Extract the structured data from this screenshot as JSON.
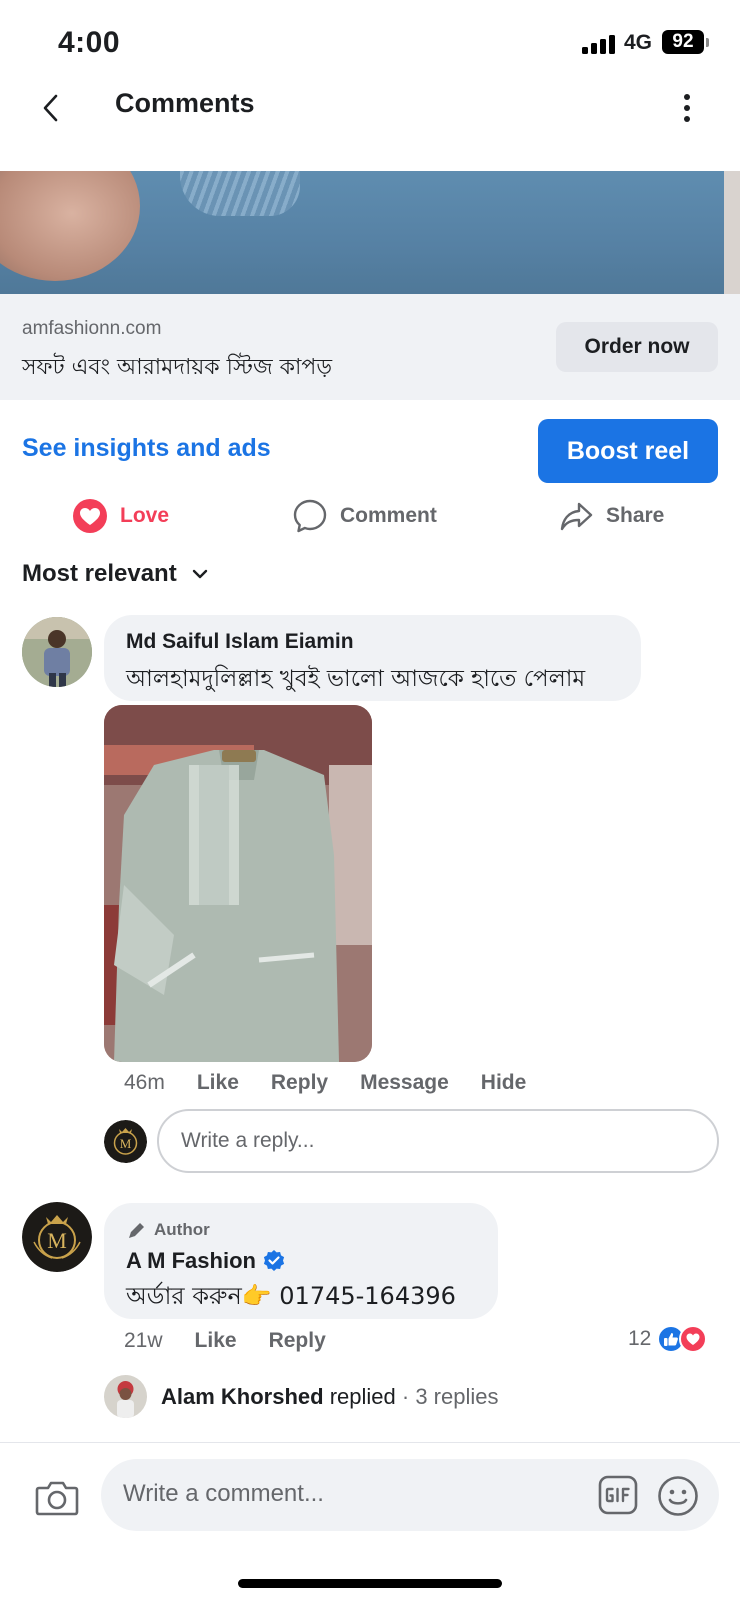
{
  "status_bar": {
    "time": "4:00",
    "network": "4G",
    "battery": "92"
  },
  "header": {
    "title": "Comments",
    "back_icon": "chevron-left-icon",
    "more_icon": "vertical-dots-icon"
  },
  "link_card": {
    "domain": "amfashionn.com",
    "title": "সফট এবং আরামদায়ক স্টিজ কাপড়",
    "cta": "Order now"
  },
  "promo": {
    "insights_label": "See insights and ads",
    "boost_label": "Boost reel"
  },
  "actions": {
    "love": "Love",
    "comment": "Comment",
    "share": "Share"
  },
  "sort": {
    "label": "Most relevant"
  },
  "colors": {
    "accent_blue": "#1b74e4",
    "love_red": "#f33e58",
    "bubble_gray": "#f0f2f5",
    "meta_gray": "#65676b"
  },
  "comments": [
    {
      "name": "Md Saiful Islam Eiamin",
      "text": "আলহামদুলিল্লাহ খুবই ভালো আজকে হাতে পেলাম",
      "time": "46m",
      "like": "Like",
      "reply": "Reply",
      "message": "Message",
      "hide": "Hide"
    },
    {
      "author_tag": "Author",
      "name": "A M Fashion",
      "text": "অর্ডার করুন👉 01745-164396",
      "time": "21w",
      "like": "Like",
      "reply": "Reply",
      "reaction_count": "12"
    }
  ],
  "reply_input": {
    "placeholder": "Write a reply..."
  },
  "replies": {
    "name": "Alam Khorshed",
    "action": "replied",
    "count": "· 3 replies"
  },
  "composer": {
    "placeholder": "Write a comment..."
  },
  "brand": {
    "logo_letter": "M"
  }
}
